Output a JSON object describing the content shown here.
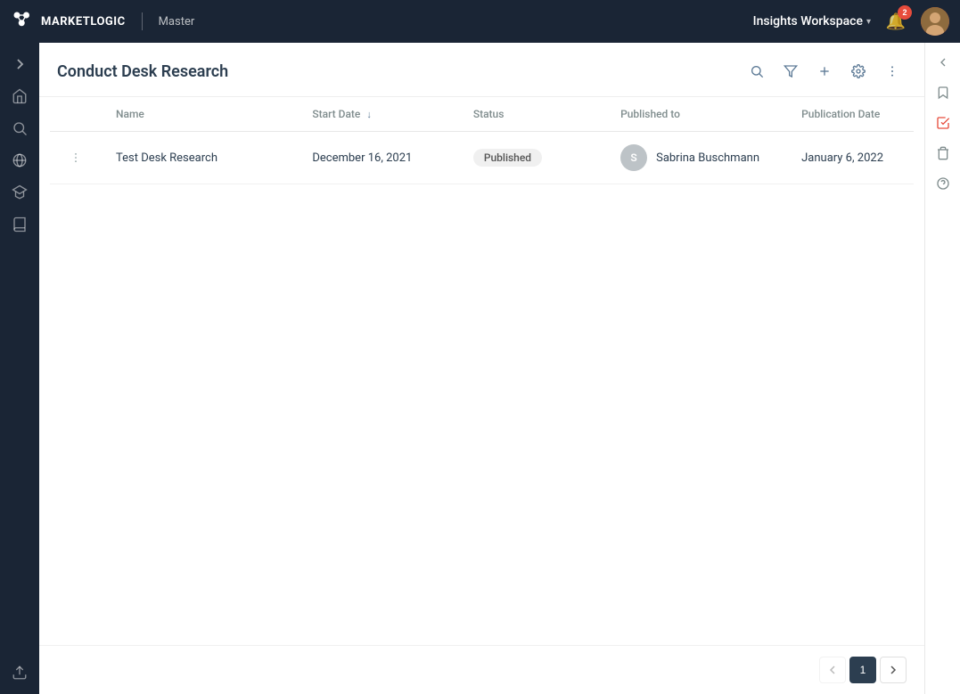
{
  "header": {
    "logo_text": "MARKETLOGIC",
    "separator": "|",
    "instance": "Master",
    "workspace_label": "Insights Workspace",
    "notification_count": "2"
  },
  "page": {
    "title": "Conduct Desk Research"
  },
  "toolbar": {
    "search_title": "Search",
    "filter_title": "Filter",
    "add_title": "Add",
    "settings_title": "Settings",
    "more_title": "More options"
  },
  "table": {
    "columns": [
      {
        "id": "name",
        "label": "Name"
      },
      {
        "id": "start_date",
        "label": "Start Date",
        "sortable": true
      },
      {
        "id": "status",
        "label": "Status"
      },
      {
        "id": "published_to",
        "label": "Published to"
      },
      {
        "id": "publication_date",
        "label": "Publication Date"
      }
    ],
    "rows": [
      {
        "name": "Test Desk Research",
        "start_date": "December 16, 2021",
        "status": "Published",
        "published_to_initial": "S",
        "published_to_name": "Sabrina Buschmann",
        "publication_date": "January 6, 2022"
      }
    ]
  },
  "pagination": {
    "current_page": 1,
    "total_pages": 1
  },
  "sidebar_left": {
    "icons": [
      "home",
      "search",
      "globe",
      "graduation-cap",
      "book",
      "upload"
    ]
  },
  "sidebar_right": {
    "icons": [
      "bookmark",
      "clipboard-check",
      "trash",
      "question-circle"
    ]
  }
}
